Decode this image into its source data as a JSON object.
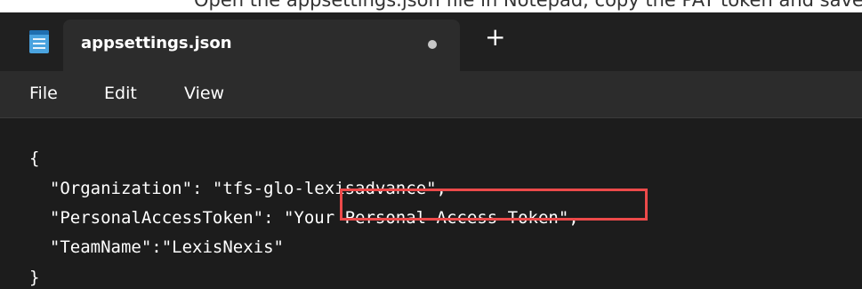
{
  "caption": {
    "text": "Open the appsettings.json file in Notepad, copy the PAT token and save the appsettings.json file."
  },
  "tab": {
    "title": "appsettings.json",
    "unsaved_indicator": "dot-icon",
    "new_tab_icon": "plus-icon"
  },
  "menu": {
    "items": [
      "File",
      "Edit",
      "View"
    ]
  },
  "editor": {
    "lines": [
      "{",
      "  \"Organization\": \"tfs-glo-lexisadvance\",",
      "  \"PersonalAccessToken\": \"Your Personal Access Token\",",
      "  \"TeamName\":\"LexisNexis\"",
      "}"
    ]
  },
  "annotation": {
    "highlight_color": "#ec4a4a"
  }
}
